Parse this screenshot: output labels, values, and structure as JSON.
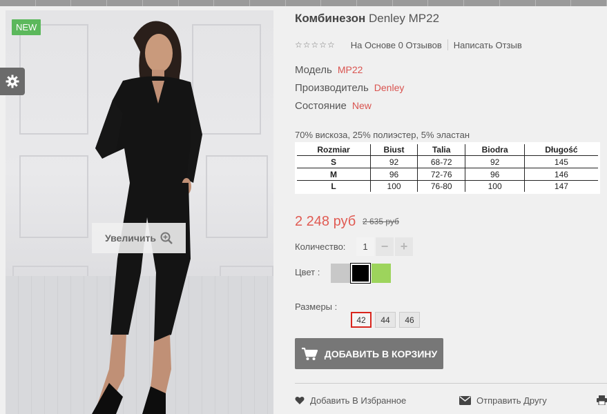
{
  "product": {
    "badge": "NEW",
    "zoom_label": "Увеличить",
    "title_bold": "Комбинезон",
    "title_rest": "Denley MP22",
    "stars": "☆☆☆☆☆",
    "reviews_text": "На Основе 0 Отзывов",
    "write_review": "Написать Отзыв",
    "attributes": [
      {
        "label": "Модель",
        "value": "MP22"
      },
      {
        "label": "Производитель",
        "value": "Denley"
      },
      {
        "label": "Состояние",
        "value": "New"
      }
    ],
    "composition": "70% вискоза, 25% полиэстер, 5% эластан",
    "size_table": {
      "headers": [
        "Rozmiar",
        "Biust",
        "Talia",
        "Biodra",
        "Długość"
      ],
      "rows": [
        [
          "S",
          "92",
          "68-72",
          "92",
          "145"
        ],
        [
          "M",
          "96",
          "72-76",
          "96",
          "146"
        ],
        [
          "L",
          "100",
          "76-80",
          "100",
          "147"
        ]
      ]
    },
    "price": "2 248 руб",
    "old_price": "2 635 руб",
    "quantity_label": "Количество:",
    "quantity": "1",
    "minus": "−",
    "plus": "+",
    "color_label": "Цвет :",
    "colors": [
      "#c8c8c8",
      "#000000",
      "#9dd45c"
    ],
    "sizes_label": "Размеры :",
    "sizes": [
      "42",
      "44",
      "46"
    ],
    "selected_size": "42",
    "add_to_cart": "ДОБАВИТЬ В КОРЗИНУ",
    "wishlist": "Добавить В Избранное",
    "send_friend": "Отправить Другу"
  }
}
